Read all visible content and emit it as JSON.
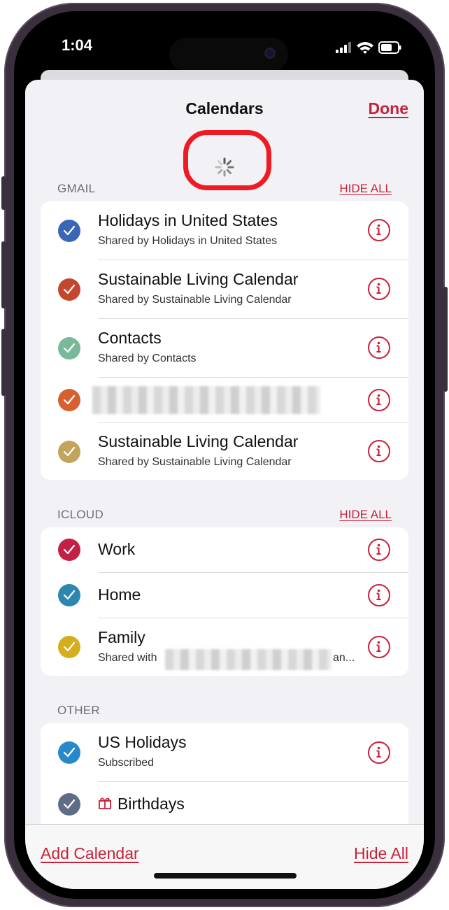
{
  "status_bar": {
    "time": "1:04"
  },
  "sheet": {
    "title": "Calendars",
    "done_label": "Done"
  },
  "sections": [
    {
      "header": "GMAIL",
      "hide_all_label": "HIDE ALL",
      "items": [
        {
          "title": "Holidays in United States",
          "subtitle": "Shared by Holidays in United States",
          "color": "#3a66b8"
        },
        {
          "title": "Sustainable Living Calendar",
          "subtitle": "Shared by Sustainable Living Calendar",
          "color": "#c5462e"
        },
        {
          "title": "Contacts",
          "subtitle": "Shared by Contacts",
          "color": "#79b99a"
        },
        {
          "title": "",
          "subtitle": "",
          "color": "#d6602f"
        },
        {
          "title": "Sustainable Living Calendar",
          "subtitle": "Shared by Sustainable Living Calendar",
          "color": "#c2a45c"
        }
      ]
    },
    {
      "header": "ICLOUD",
      "hide_all_label": "HIDE ALL",
      "items": [
        {
          "title": "Work",
          "subtitle": "",
          "color": "#c51f45"
        },
        {
          "title": "Home",
          "subtitle": "",
          "color": "#2c86b0"
        },
        {
          "title": "Family",
          "subtitle_prefix": "Shared with",
          "subtitle_suffix": "an...",
          "color": "#d4ae1b"
        }
      ]
    },
    {
      "header": "OTHER",
      "items": [
        {
          "title": "US Holidays",
          "subtitle": "Subscribed",
          "color": "#2789c9"
        },
        {
          "title": "Birthdays",
          "subtitle": "",
          "color": "#5f6c85"
        }
      ]
    }
  ],
  "toolbar": {
    "add_calendar_label": "Add Calendar",
    "hide_all_label": "Hide All"
  },
  "colors": {
    "accent": "#c8213a",
    "highlight_ring": "#ee1b24"
  }
}
